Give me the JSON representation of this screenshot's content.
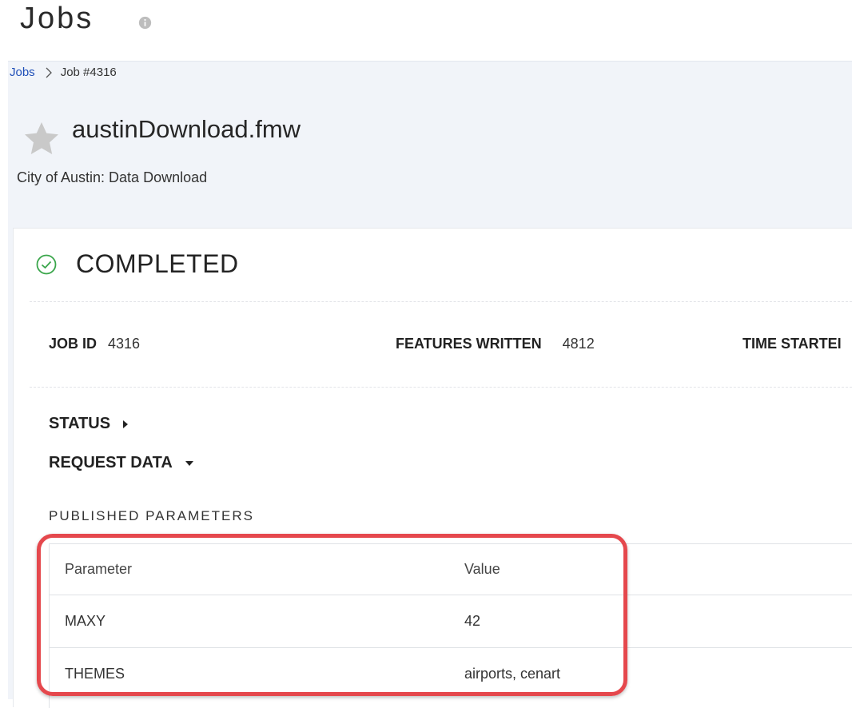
{
  "header": {
    "title": "Jobs",
    "info_icon": "info-icon"
  },
  "breadcrumb": {
    "items": [
      "Jobs",
      "Job #4316"
    ],
    "separator_icon": "chevron-right-icon"
  },
  "workspace": {
    "favorite_icon": "star-icon",
    "name": "austinDownload.fmw",
    "description": "City of Austin: Data Download"
  },
  "job": {
    "status_icon": "check-circle-icon",
    "status": "COMPLETED",
    "status_color": "#3aa64b",
    "summary": [
      {
        "label": "JOB ID",
        "value": "4316"
      },
      {
        "label": "FEATURES WRITTEN",
        "value": "4812"
      },
      {
        "label": "TIME STARTEI",
        "value": ""
      }
    ],
    "sections": [
      {
        "label": "STATUS",
        "icon": "caret-right-icon"
      },
      {
        "label": "REQUEST DATA",
        "icon": "caret-down-icon"
      }
    ]
  },
  "published_parameters": {
    "heading": "PUBLISHED PARAMETERS",
    "columns": [
      "Parameter",
      "Value"
    ],
    "rows": [
      {
        "parameter": "MAXY",
        "value": "42"
      },
      {
        "parameter": "THEMES",
        "value": "airports, cenart"
      }
    ]
  },
  "colors": {
    "accent_link": "#1f4fb8",
    "highlight": "#e5484d",
    "content_bg": "#f1f4f9"
  }
}
